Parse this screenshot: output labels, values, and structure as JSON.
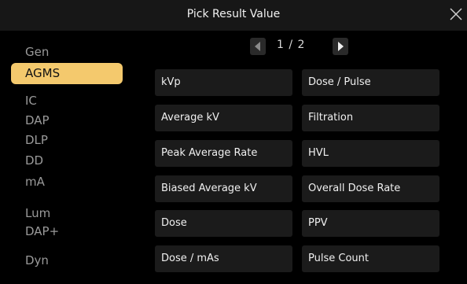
{
  "title": "Pick Result Value",
  "sidebar": {
    "items": [
      {
        "label": "Gen",
        "active": false
      },
      {
        "label": "AGMS",
        "active": true
      },
      {
        "label": "IC",
        "active": false
      },
      {
        "label": "DAP",
        "active": false
      },
      {
        "label": "DLP",
        "active": false
      },
      {
        "label": "DD",
        "active": false
      },
      {
        "label": "mA",
        "active": false
      },
      {
        "label": "Lum",
        "active": false
      },
      {
        "label": "DAP+",
        "active": false
      },
      {
        "label": "Dyn",
        "active": false
      }
    ]
  },
  "pager": {
    "text": "1 / 2"
  },
  "results": [
    "kVp",
    "Dose / Pulse",
    "Average kV",
    "Filtration",
    "Peak Average Rate",
    "HVL",
    "Biased Average kV",
    "Overall Dose Rate",
    "Dose",
    "PPV",
    "Dose / mAs",
    "Pulse Count"
  ],
  "colors": {
    "accent": "#f4c96d",
    "button_bg": "#1b1b1b",
    "title_bg": "#171717"
  }
}
